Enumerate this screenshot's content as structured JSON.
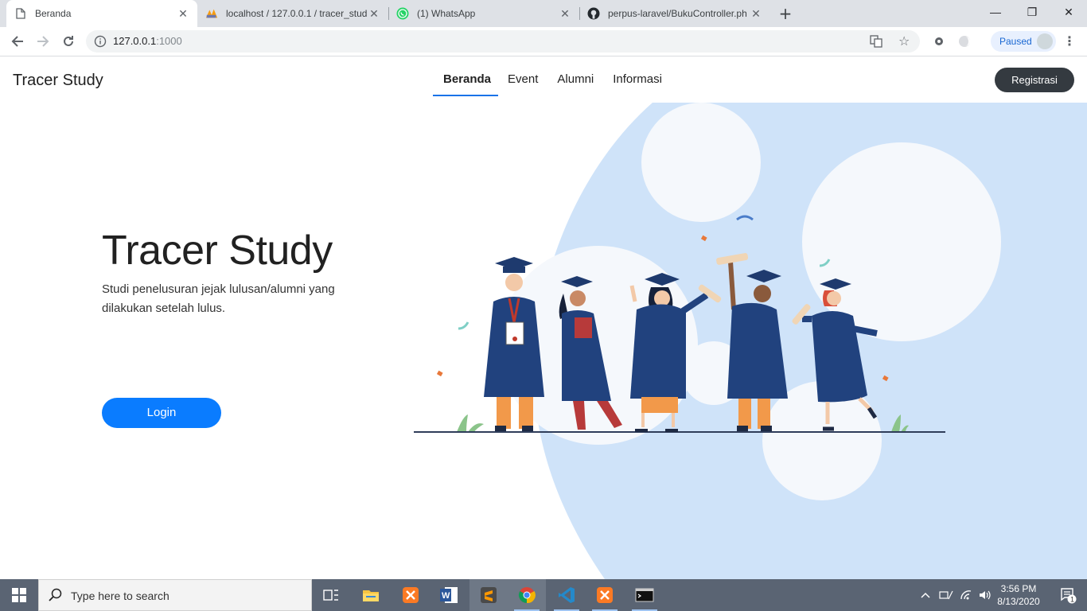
{
  "browser": {
    "tabs": [
      {
        "title": "Beranda",
        "icon": "document-icon",
        "active": true
      },
      {
        "title": "localhost / 127.0.0.1 / tracer_stud",
        "icon": "phpmyadmin-icon",
        "active": false
      },
      {
        "title": "(1) WhatsApp",
        "icon": "whatsapp-icon",
        "active": false
      },
      {
        "title": "perpus-laravel/BukuController.ph",
        "icon": "github-icon",
        "active": false
      }
    ],
    "url_host": "127.0.0.1",
    "url_port": ":1000",
    "profile_label": "Paused"
  },
  "site": {
    "brand": "Tracer Study",
    "nav": [
      "Beranda",
      "Event",
      "Alumni",
      "Informasi"
    ],
    "active_nav": "Beranda",
    "register_label": "Registrasi",
    "hero_title": "Tracer Study",
    "hero_subtitle": "Studi penelusuran jejak lulusan/alumni yang dilakukan setelah lulus.",
    "login_label": "Login"
  },
  "taskbar": {
    "search_placeholder": "Type here to search",
    "time": "3:56 PM",
    "date": "8/13/2020",
    "notification_count": "1",
    "apps": [
      "task-view-icon",
      "file-explorer-icon",
      "xampp-icon",
      "word-icon",
      "sublime-icon",
      "chrome-icon",
      "vscode-icon",
      "xampp-icon",
      "terminal-icon"
    ]
  },
  "colors": {
    "accent": "#1a73e8",
    "login_button": "#0a7cff",
    "register_button": "#343a40",
    "hero_blob": "#cfe3f9",
    "gown": "#21427e"
  }
}
